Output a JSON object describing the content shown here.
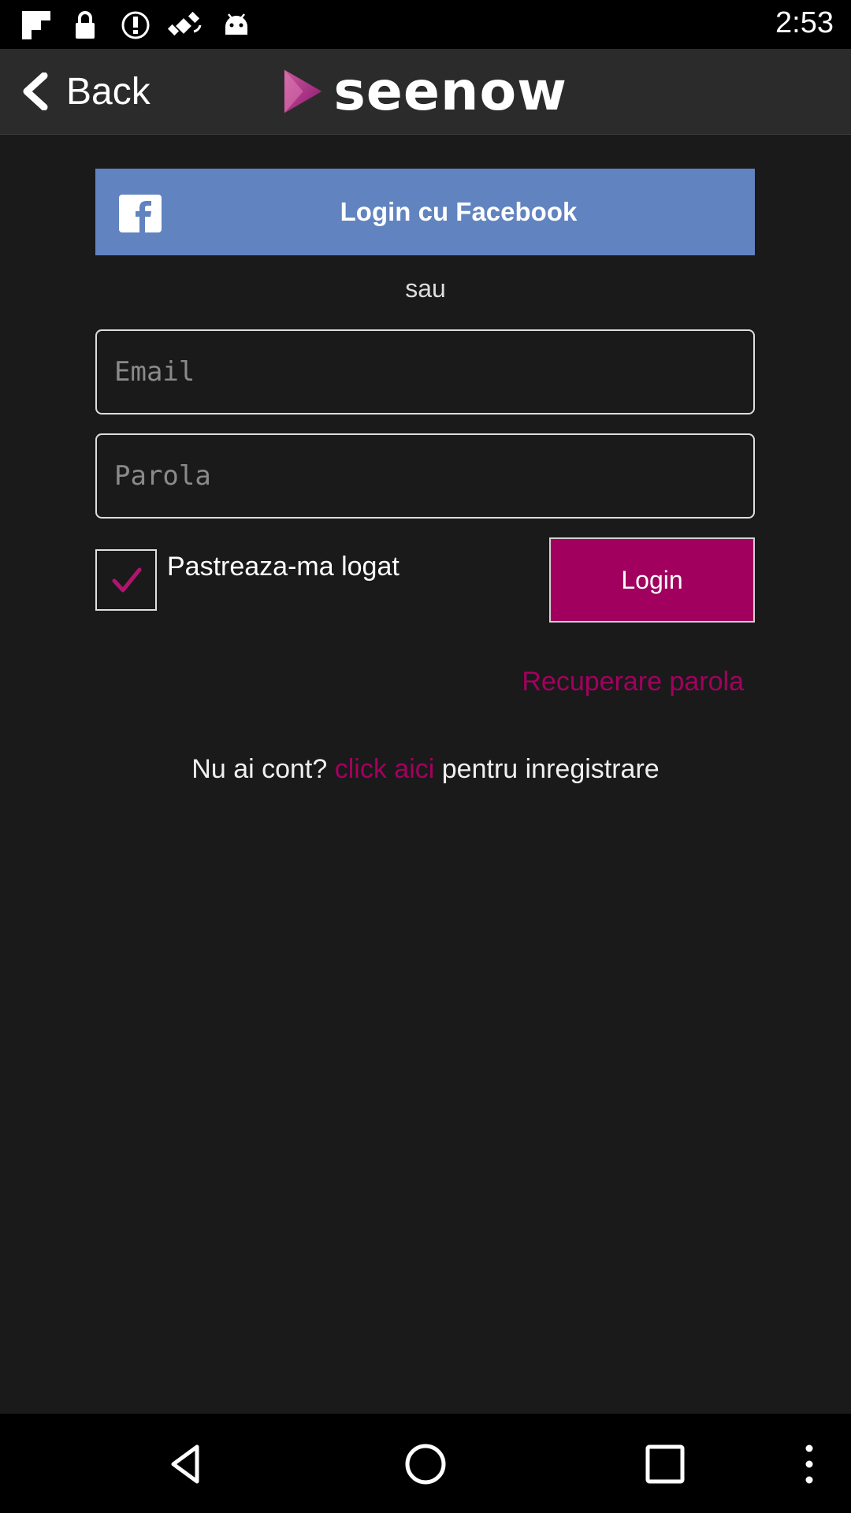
{
  "status_bar": {
    "time": "2:53",
    "icons": [
      "flipboard-icon",
      "lock-icon",
      "alert-icon",
      "fake-gps-icon",
      "android-icon"
    ]
  },
  "header": {
    "back_label": "Back",
    "logo_text": "seenow"
  },
  "login": {
    "facebook_label": "Login cu Facebook",
    "or_text": "sau",
    "email_placeholder": "Email",
    "password_placeholder": "Parola",
    "remember_label": "Pastreaza-ma logat",
    "remember_checked": true,
    "login_label": "Login",
    "recover_label": "Recuperare parola",
    "register_prefix": "Nu ai cont? ",
    "register_link": "click aici",
    "register_suffix": " pentru inregistrare"
  },
  "colors": {
    "background": "#1a1a1a",
    "facebook_blue": "#6183c0",
    "accent_magenta": "#a2005e"
  },
  "nav_bar": {
    "buttons": [
      "back-icon",
      "home-icon",
      "recents-icon",
      "menu-icon"
    ]
  }
}
